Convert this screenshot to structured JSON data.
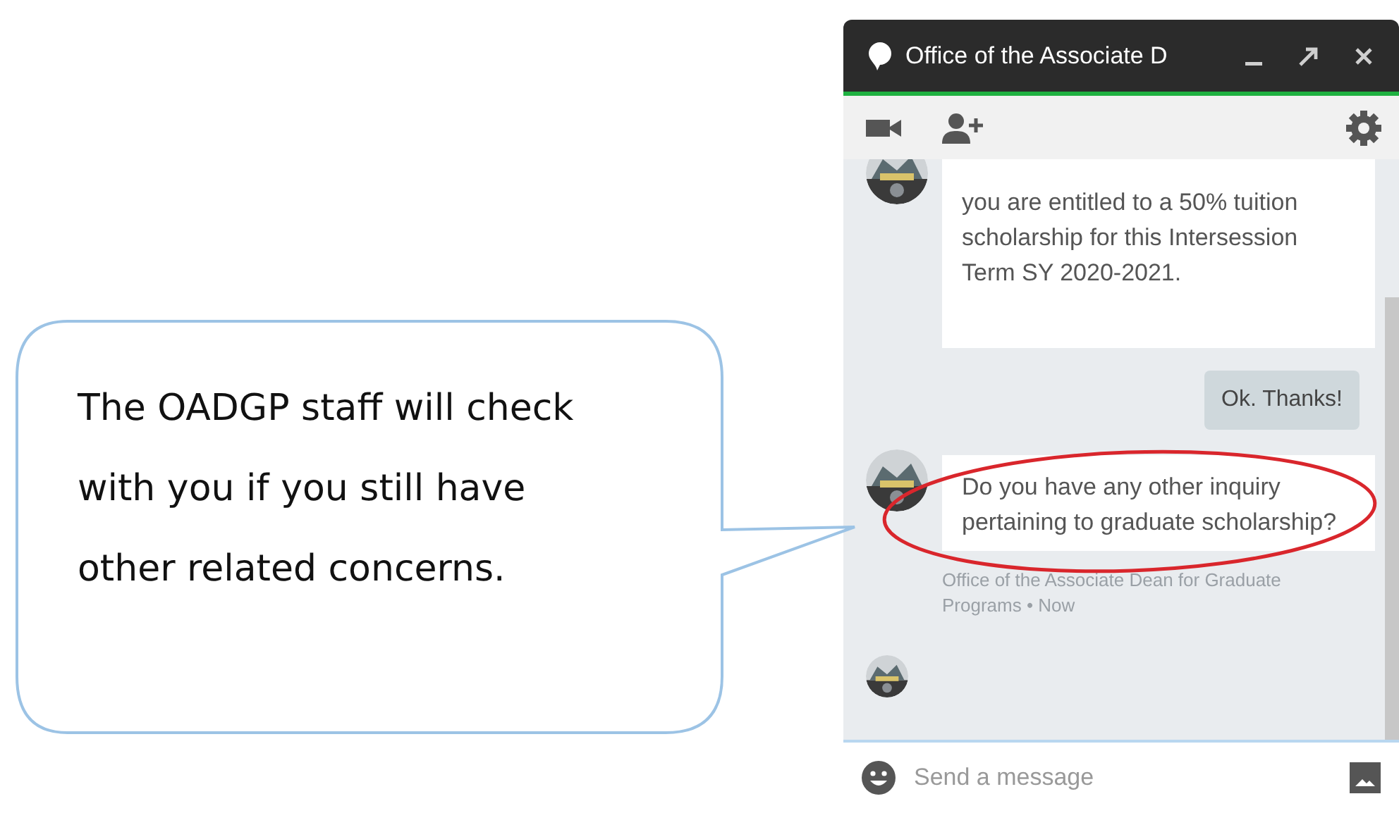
{
  "chat_window": {
    "title": "Office of the Associate D",
    "messages": [
      {
        "kind": "incoming",
        "text": "you are entitled to a 50% tuition scholarship for this Intersession Term SY 2020-2021.",
        "highlighted": false
      },
      {
        "kind": "outgoing",
        "text": "Ok. Thanks!"
      },
      {
        "kind": "incoming",
        "text": "Do you have any other inquiry pertaining to graduate scholarship?",
        "highlighted": true,
        "meta": "Office of the Associate Dean for Graduate Programs • Now"
      }
    ],
    "seen": true,
    "input": {
      "placeholder": "Send a message"
    }
  },
  "callout": {
    "text": "The OADGP staff will check with you if you still have other related concerns."
  }
}
